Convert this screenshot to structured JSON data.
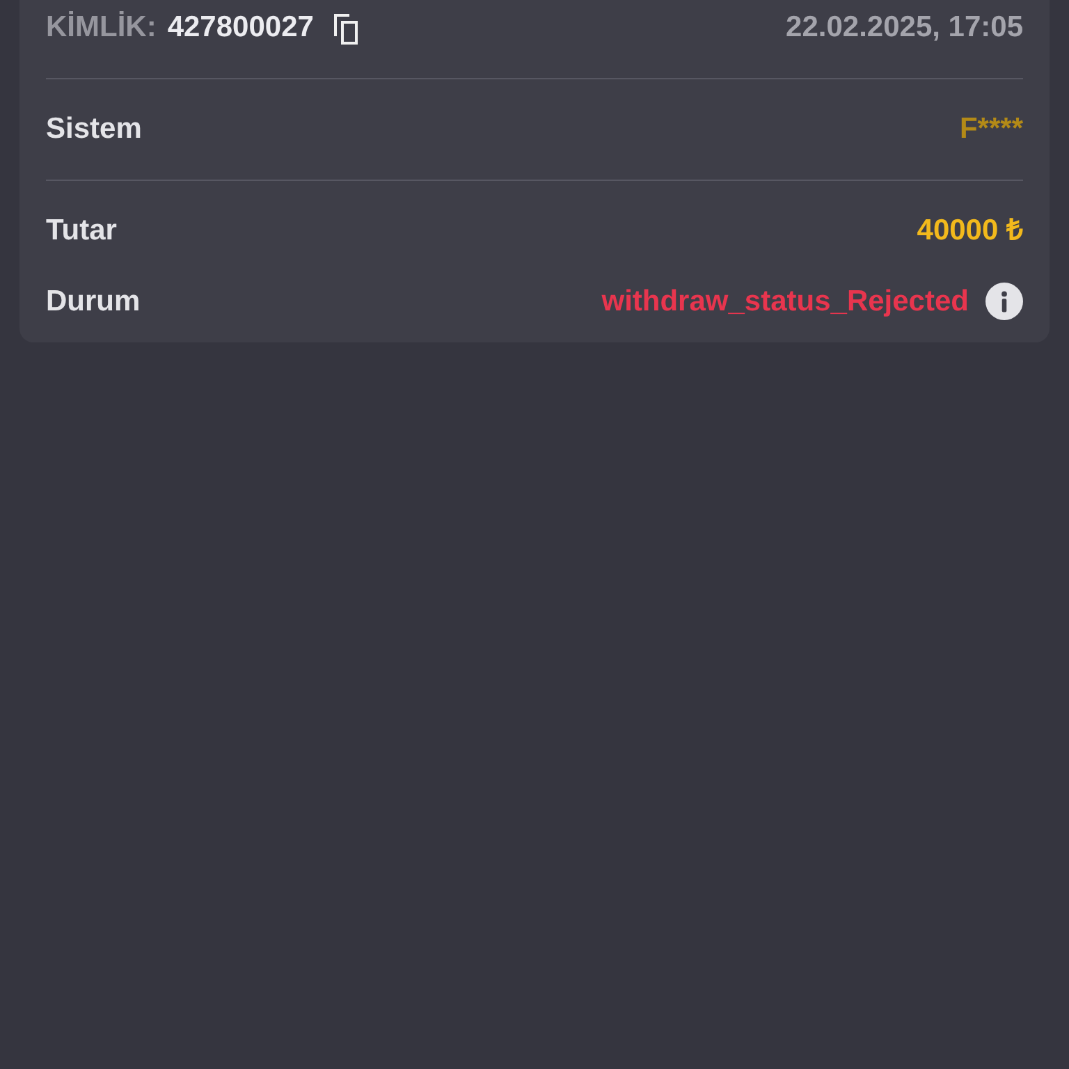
{
  "header": {
    "id_label": "KİMLİK:",
    "id_value": "427800027",
    "date": "22.02.2025, 17:05"
  },
  "sections": [
    {
      "rows": [
        {
          "label": "Sistem",
          "value": "F****",
          "color": "#b38a17",
          "kind": "text"
        }
      ]
    },
    {
      "rows": [
        {
          "label": "Tutar",
          "value": "40000 ₺",
          "color": "#f2b91c",
          "kind": "text"
        },
        {
          "label": "Durum",
          "value": "withdraw_status_Rejected",
          "color": "#e8354e",
          "kind": "status"
        }
      ]
    }
  ]
}
